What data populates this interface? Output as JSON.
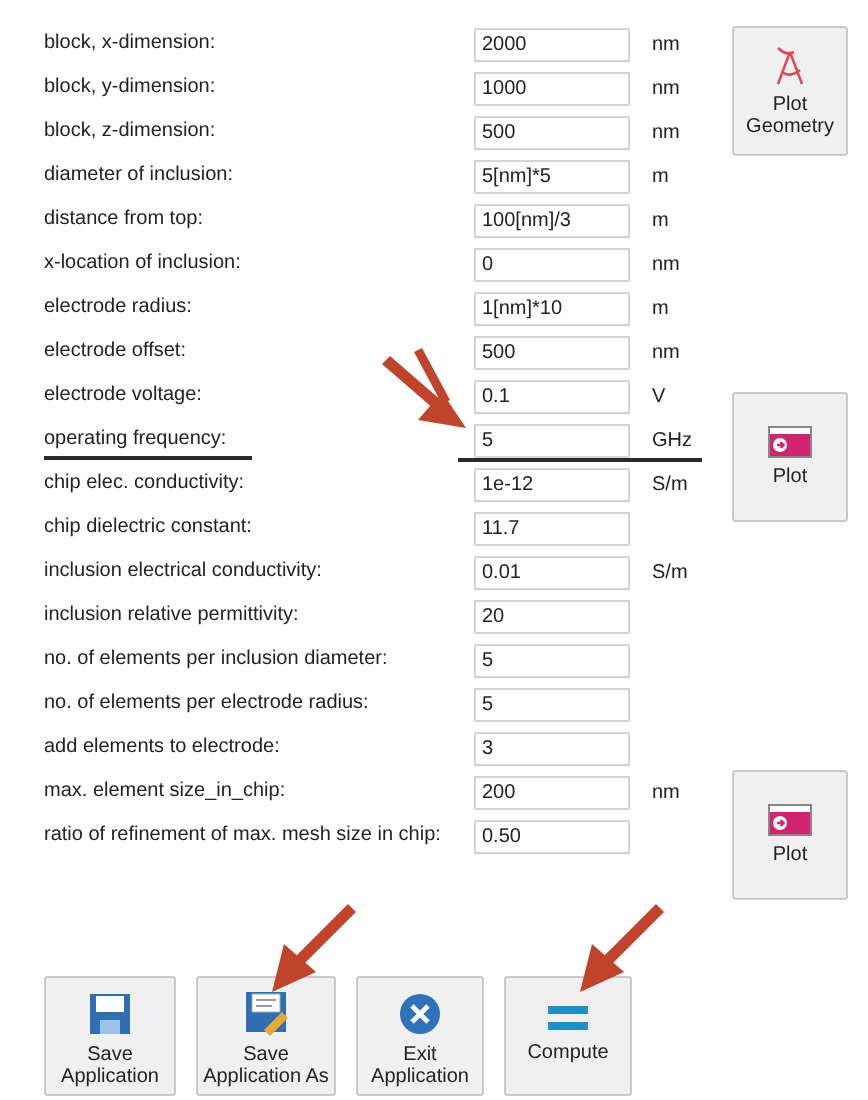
{
  "parameters": [
    {
      "label": "block, x-dimension:",
      "value": "2000",
      "unit": "nm",
      "underlined": false,
      "arrow": false
    },
    {
      "label": "block, y-dimension:",
      "value": "1000",
      "unit": "nm",
      "underlined": false,
      "arrow": false
    },
    {
      "label": "block, z-dimension:",
      "value": "500",
      "unit": "nm",
      "underlined": false,
      "arrow": false
    },
    {
      "label": "diameter of inclusion:",
      "value": "5[nm]*5",
      "unit": "m",
      "underlined": false,
      "arrow": false
    },
    {
      "label": "distance from top:",
      "value": "100[nm]/3",
      "unit": "m",
      "underlined": false,
      "arrow": false
    },
    {
      "label": "x-location of inclusion:",
      "value": "0",
      "unit": "nm",
      "underlined": false,
      "arrow": false
    },
    {
      "label": "electrode radius:",
      "value": "1[nm]*10",
      "unit": "m",
      "underlined": false,
      "arrow": false
    },
    {
      "label": "electrode offset:",
      "value": "500",
      "unit": "nm",
      "underlined": false,
      "arrow": false
    },
    {
      "label": "electrode voltage:",
      "value": "0.1",
      "unit": "V",
      "underlined": false,
      "arrow": false
    },
    {
      "label": "operating frequency:",
      "value": "5",
      "unit": "GHz",
      "underlined": true,
      "arrow": true
    },
    {
      "label": "chip elec. conductivity:",
      "value": "1e-12",
      "unit": "S/m",
      "underlined": false,
      "arrow": false
    },
    {
      "label": "chip dielectric constant:",
      "value": "11.7",
      "underlined": false,
      "arrow": false
    },
    {
      "label": "inclusion electrical conductivity:",
      "value": "0.01",
      "unit": "S/m",
      "underlined": false,
      "arrow": false
    },
    {
      "label": "inclusion relative permittivity:",
      "value": "20",
      "underlined": false,
      "arrow": false
    },
    {
      "label": "no. of elements per inclusion diameter:",
      "value": "5",
      "underlined": false,
      "arrow": false
    },
    {
      "label": "no. of elements per electrode radius:",
      "value": "5",
      "underlined": false,
      "arrow": false
    },
    {
      "label": "add elements to electrode:",
      "value": "3",
      "underlined": false,
      "arrow": false
    },
    {
      "label": "max. element size_in_chip:",
      "value": "200",
      "unit": "nm",
      "underlined": false,
      "arrow": false
    },
    {
      "label": "ratio of refinement of max. mesh size in chip:",
      "value": "0.50",
      "underlined": false,
      "arrow": false
    }
  ],
  "side_buttons": [
    {
      "kind": "geometry",
      "label": "Plot Geometry"
    },
    {
      "kind": "plot",
      "label": "Plot"
    },
    {
      "kind": "plot",
      "label": "Plot"
    }
  ],
  "bottom_buttons": [
    {
      "kind": "save",
      "label": "Save Application",
      "arrow": false
    },
    {
      "kind": "save_as",
      "label": "Save Application As",
      "arrow": true
    },
    {
      "kind": "exit",
      "label": "Exit Application",
      "arrow": false
    },
    {
      "kind": "compute",
      "label": "Compute",
      "arrow": true
    }
  ]
}
